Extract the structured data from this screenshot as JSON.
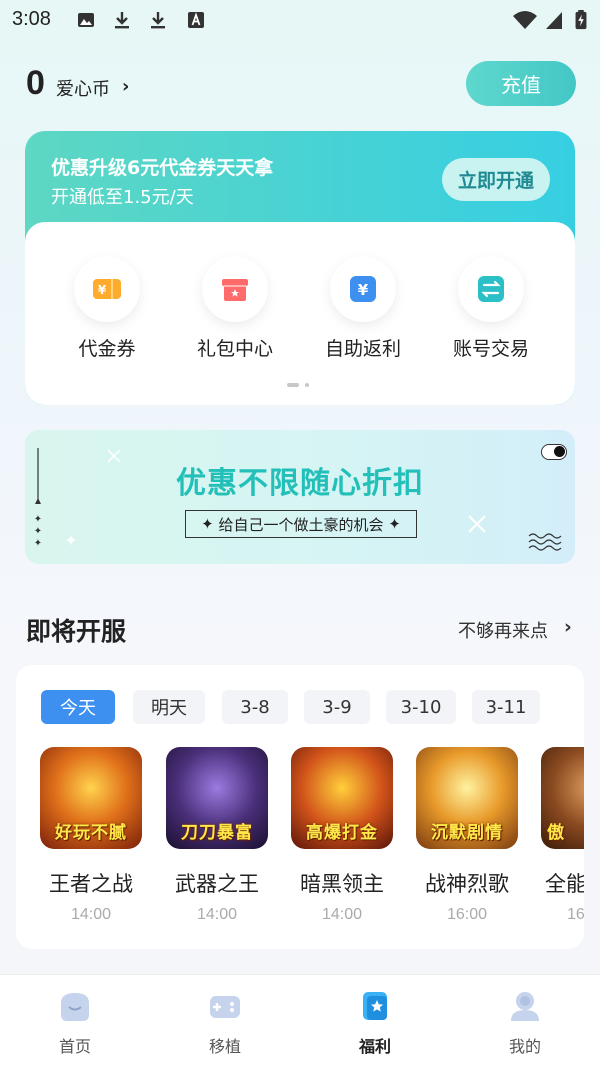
{
  "status": {
    "time": "3:08",
    "left_icons": [
      "image-icon",
      "download-icon",
      "download-icon",
      "a-box-icon"
    ],
    "right_icons": [
      "wifi-icon",
      "signal-icon",
      "battery-icon"
    ]
  },
  "wallet": {
    "coins": "0",
    "label": "爱心币",
    "recharge": "充值"
  },
  "promo": {
    "title": "优惠升级6元代金券天天拿",
    "subtitle": "开通低至1.5元/天",
    "button": "立即开通",
    "features": [
      {
        "label": "代金券",
        "icon": "voucher-icon",
        "color": "#ffab2e"
      },
      {
        "label": "礼包中心",
        "icon": "gift-box-icon",
        "color": "#ff6b6b"
      },
      {
        "label": "自助返利",
        "icon": "rebate-icon",
        "color": "#3d8ff0"
      },
      {
        "label": "账号交易",
        "icon": "exchange-icon",
        "color": "#2bbfc7"
      }
    ]
  },
  "banner": {
    "title": "优惠不限随心折扣",
    "tagline": "给自己一个做土豪的机会"
  },
  "upcoming": {
    "title": "即将开服",
    "more": "不够再来点",
    "tabs": [
      "今天",
      "明天",
      "3-8",
      "3-9",
      "3-10",
      "3-11"
    ],
    "games": [
      {
        "name": "王者之战",
        "time": "14:00",
        "caption": "好玩不腻",
        "color": "#c7481b"
      },
      {
        "name": "武器之王",
        "time": "14:00",
        "caption": "刀刀暴富",
        "color": "#5a3d8a"
      },
      {
        "name": "暗黑领主",
        "time": "14:00",
        "caption": "高爆打金",
        "color": "#b5481f"
      },
      {
        "name": "战神烈歌",
        "time": "16:00",
        "caption": "沉默剧情",
        "color": "#c9761f"
      },
      {
        "name": "全能",
        "time": "16",
        "caption": "傲",
        "color": "#7a4a22"
      }
    ]
  },
  "nav": {
    "items": [
      {
        "label": "首页",
        "icon": "home-icon"
      },
      {
        "label": "移植",
        "icon": "gamepad-icon"
      },
      {
        "label": "福利",
        "icon": "welfare-star-icon"
      },
      {
        "label": "我的",
        "icon": "profile-icon"
      }
    ],
    "active_index": 2
  }
}
